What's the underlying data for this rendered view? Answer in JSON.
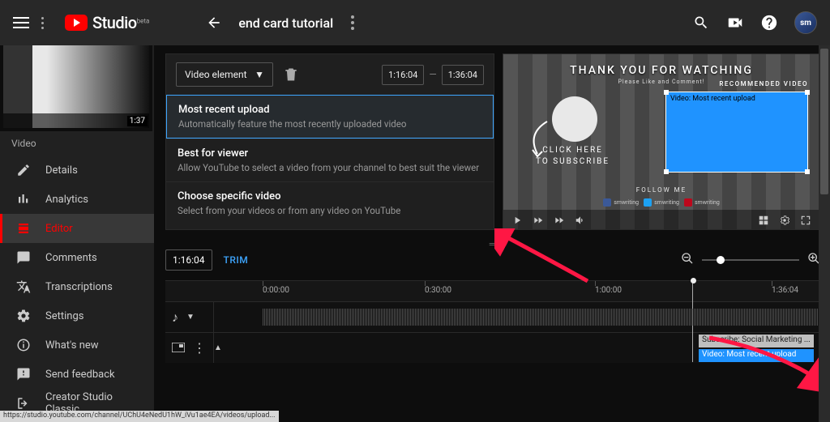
{
  "app": {
    "name": "Studio",
    "suffix": "beta"
  },
  "header": {
    "title": "end card tutorial"
  },
  "thumbnail": {
    "duration": "1:37"
  },
  "sidebar_label": "Video",
  "nav": [
    {
      "label": "Details"
    },
    {
      "label": "Analytics"
    },
    {
      "label": "Editor"
    },
    {
      "label": "Comments"
    },
    {
      "label": "Transcriptions"
    },
    {
      "label": "Settings"
    },
    {
      "label": "What's new"
    },
    {
      "label": "Send feedback"
    },
    {
      "label": "Creator Studio Classic"
    }
  ],
  "element_panel": {
    "dropdown_label": "Video element",
    "range_start": "1:16:04",
    "range_end": "1:36:04",
    "options": [
      {
        "title": "Most recent upload",
        "desc": "Automatically feature the most recently uploaded video"
      },
      {
        "title": "Best for viewer",
        "desc": "Allow YouTube to select a video from your channel to best suit the viewer"
      },
      {
        "title": "Choose specific video",
        "desc": "Select from your videos or from any video on YouTube"
      }
    ]
  },
  "preview": {
    "headline": "THANK YOU FOR WATCHING",
    "subline": "Please Like and Comment!",
    "recommended_label": "RECOMMENDED VIDEO",
    "card_text": "Video: Most recent upload",
    "click_cta_line1": "CLICK HERE",
    "click_cta_line2": "TO SUBSCRIBE",
    "follow_label": "FOLLOW ME",
    "social_handle": "smwriting"
  },
  "timeline": {
    "current": "1:16:04",
    "trim_label": "TRIM",
    "ticks": [
      "0:00:00",
      "0:30:00",
      "1:00:00",
      "1:36:04"
    ],
    "chips": {
      "subscribe": "Subscribe: Social Marketing ...",
      "video": "Video: Most recent upload"
    }
  },
  "status_url": "https://studio.youtube.com/channel/UChU4eNedU1hW_iVu1ae4EA/videos/upload..."
}
